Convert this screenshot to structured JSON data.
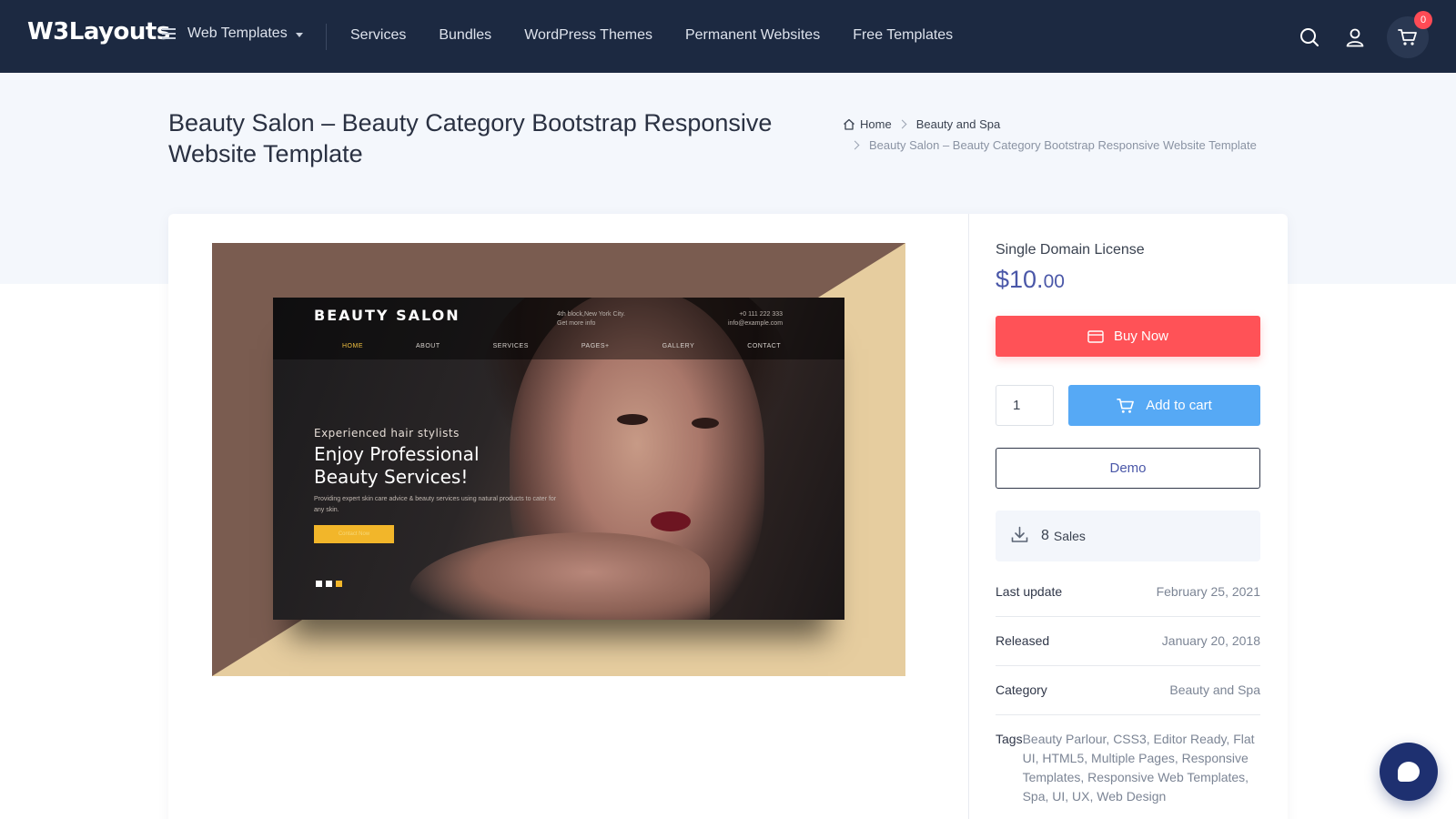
{
  "nav": {
    "logo": "W3Layouts",
    "menu_label": "Web Templates",
    "links": [
      "Services",
      "Bundles",
      "WordPress Themes",
      "Permanent Websites",
      "Free Templates"
    ],
    "cart_count": "0",
    "icons": [
      "search-icon",
      "user-icon",
      "cart-icon"
    ],
    "bg_color": "#1c2941"
  },
  "page": {
    "title": "Beauty Salon – Beauty Category Bootstrap Responsive Website Template",
    "breadcrumb": {
      "home": "Home",
      "category": "Beauty and Spa",
      "current": "Beauty Salon – Beauty Category Bootstrap Responsive Website Template"
    }
  },
  "preview": {
    "brand": "BEAUTY SALON",
    "address_line1": "4th block,New York City.",
    "address_line2": "Get more info",
    "phone": "+0 111 222 333",
    "email": "info@example.com",
    "menu": [
      "HOME",
      "ABOUT",
      "SERVICES",
      "PAGES+",
      "GALLERY",
      "CONTACT"
    ],
    "kicker": "Experienced hair stylists",
    "headline": "Enjoy Professional Beauty Services!",
    "body": "Providing expert skin care advice & beauty services using natural products to cater for any skin.",
    "button": "Contact Now"
  },
  "product": {
    "license": "Single Domain License",
    "price_major": "$10.",
    "price_minor": "00",
    "buy_label": "Buy Now",
    "quantity": "1",
    "add_to_cart_label": "Add to cart",
    "demo_label": "Demo",
    "sales_count": "8",
    "sales_label": "Sales",
    "meta": {
      "last_update_label": "Last update",
      "last_update": "February 25, 2021",
      "released_label": "Released",
      "released": "January 20, 2018",
      "category_label": "Category",
      "category": "Beauty and Spa",
      "tags_label": "Tags",
      "tags": "Beauty Parlour, CSS3, Editor Ready, Flat UI, HTML5, Multiple Pages, Responsive Templates, Responsive Web Templates, Spa, UI, UX, Web Design"
    },
    "colors": {
      "buy": "#ff5257",
      "cart": "#56a9f5",
      "price": "#4a57a8"
    }
  }
}
